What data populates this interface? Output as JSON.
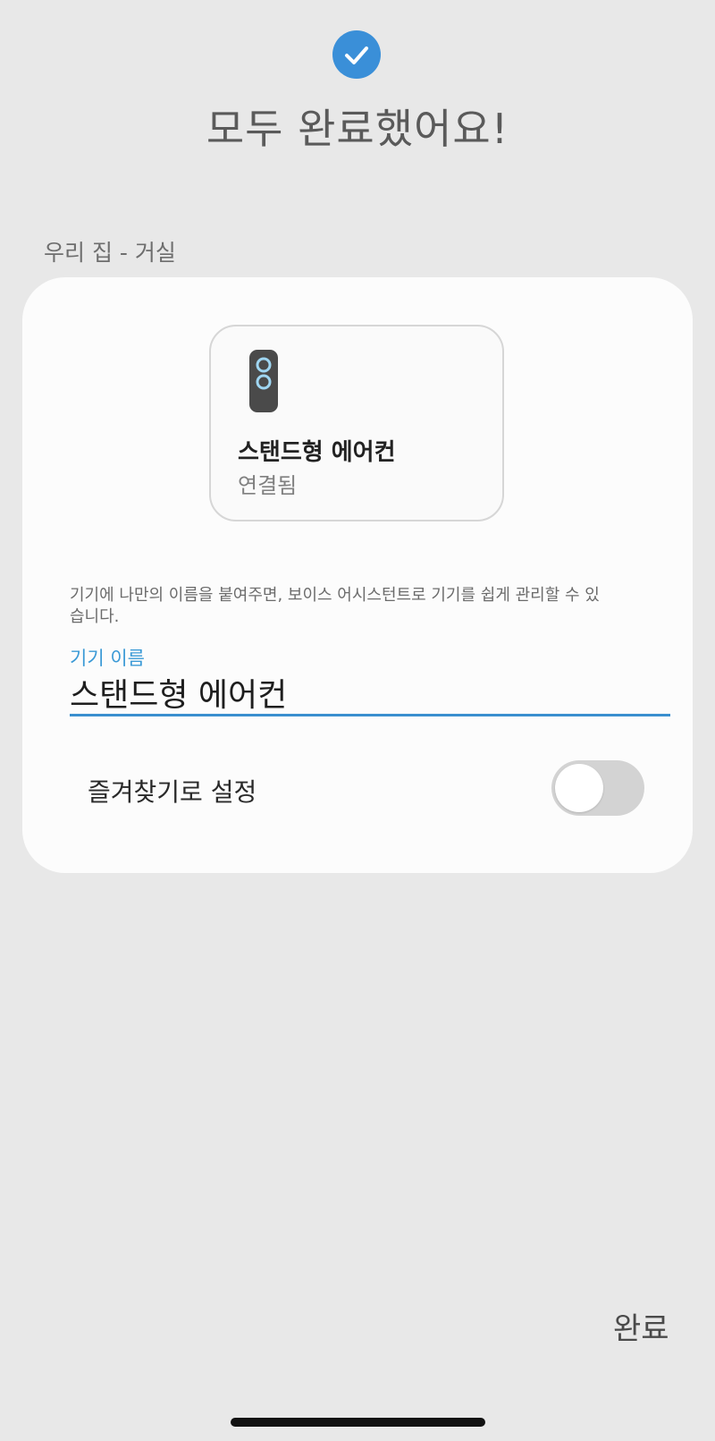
{
  "header": {
    "icon": "check-circle-icon",
    "title": "모두 완료했어요!"
  },
  "location": "우리 집 - 거실",
  "device": {
    "icon": "stand-air-conditioner-icon",
    "name": "스탠드형 에어컨",
    "status": "연결됨"
  },
  "helper_text": "기기에 나만의 이름을 붙여주면, 보이스 어시스턴트로 기기를 쉽게 관리할 수 있습니다.",
  "name_field": {
    "label": "기기 이름",
    "value": "스탠드형 에어컨"
  },
  "favorite": {
    "label": "즐겨찾기로 설정",
    "enabled": false
  },
  "done_label": "완료",
  "colors": {
    "accent": "#3a8fd8",
    "background": "#e8e8e8",
    "card": "#fcfcfc"
  }
}
